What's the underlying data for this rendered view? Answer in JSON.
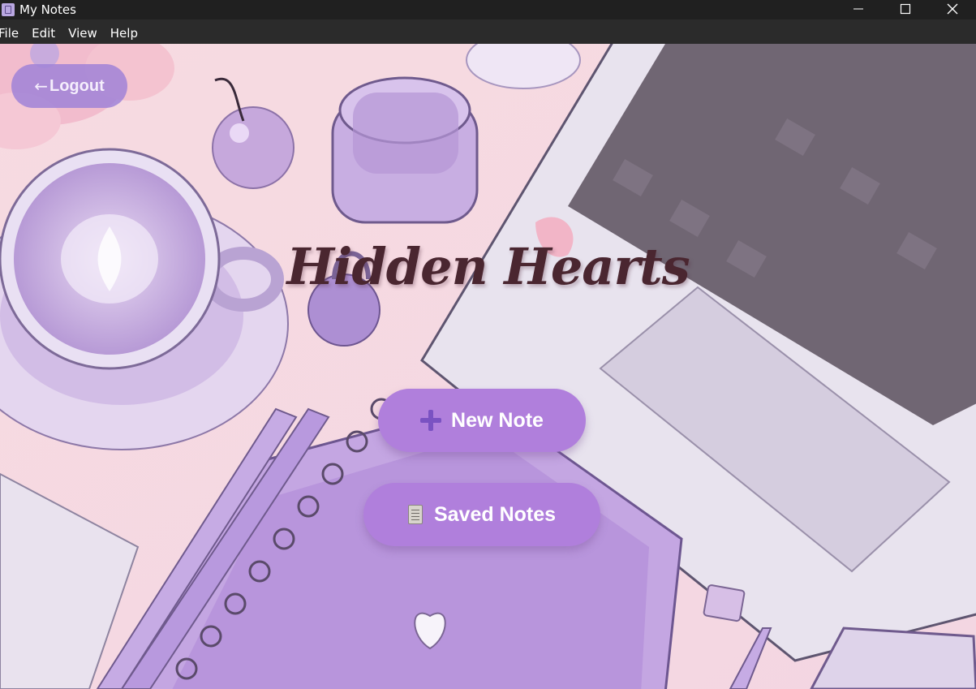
{
  "window": {
    "title": "My Notes",
    "icons": [
      "app-icon",
      "minimize-icon",
      "maximize-icon",
      "close-icon"
    ]
  },
  "menu": {
    "items": [
      "File",
      "Edit",
      "View",
      "Help"
    ]
  },
  "main": {
    "logout_arrow": "←",
    "logout_label": "Logout",
    "heading": "Hidden Hearts",
    "new_note_label": "New Note",
    "saved_notes_label": "Saved Notes",
    "new_note_icon": "plus-icon",
    "saved_notes_icon": "notepad-icon"
  },
  "colors": {
    "titlebar": "#202020",
    "menubar": "#2b2b2b",
    "background": "#f6dde3",
    "button": "#b07fdc",
    "heading": "#4a2630"
  }
}
